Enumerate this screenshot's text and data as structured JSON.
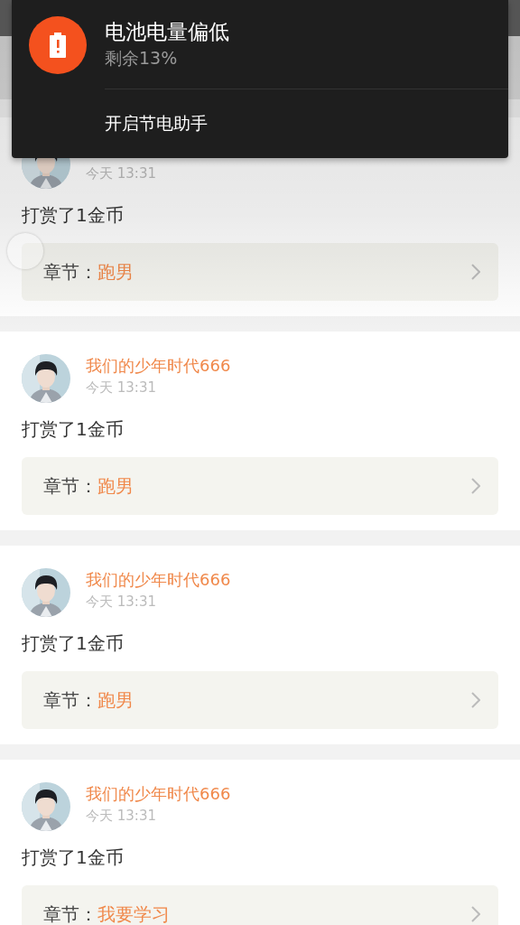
{
  "notification": {
    "title": "电池电量偏低",
    "subtitle": "剩余13%",
    "action": "开启节电助手"
  },
  "feed": [
    {
      "time": "今天 13:31",
      "message": "打赏了1金币",
      "chapter_label": "章节：",
      "chapter": "跑男"
    },
    {
      "user": "我们的少年时代666",
      "time": "今天 13:31",
      "message": "打赏了1金币",
      "chapter_label": "章节：",
      "chapter": "跑男"
    },
    {
      "user": "我们的少年时代666",
      "time": "今天 13:31",
      "message": "打赏了1金币",
      "chapter_label": "章节：",
      "chapter": "跑男"
    },
    {
      "user": "我们的少年时代666",
      "time": "今天 13:31",
      "message": "打赏了1金币",
      "chapter_label": "章节：",
      "chapter": "我要学习"
    }
  ]
}
